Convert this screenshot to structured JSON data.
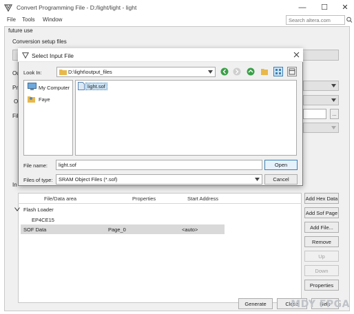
{
  "window": {
    "title": "Convert Programming File - D:/light/light - light",
    "controls": {
      "minimize": "—",
      "maximize": "☐",
      "close": "✕"
    }
  },
  "menu": {
    "items": [
      "File",
      "Tools",
      "Window"
    ]
  },
  "search": {
    "placeholder": "Search altera.com"
  },
  "panel": {
    "top_label": "future use",
    "conversion_title": "Conversion setup files",
    "left_labels": [
      "Ou",
      "Pr",
      "O",
      "Fil"
    ],
    "input_group_label": "In"
  },
  "table": {
    "headers": [
      "File/Data area",
      "Properties",
      "Start Address"
    ],
    "tree": {
      "flash_loader": "Flash Loader",
      "device": "EP4CE15",
      "sof_row": {
        "name": "SOF Data",
        "properties": "Page_0",
        "address": "<auto>"
      }
    }
  },
  "side_buttons": {
    "add_hex": "Add Hex Data",
    "add_sof_page": "Add Sof Page",
    "add_file": "Add File...",
    "remove": "Remove",
    "up": "Up",
    "down": "Down",
    "properties": "Properties",
    "more": "..."
  },
  "bottom_buttons": {
    "generate": "Generate",
    "close": "Close",
    "help": "Help"
  },
  "dialog": {
    "title": "Select Input File",
    "look_in_label": "Look In:",
    "look_in_value": "D:\\light\\output_files",
    "places": [
      "My Computer",
      "Faye"
    ],
    "files": [
      "light.sof"
    ],
    "file_name_label": "File name:",
    "file_name_value": "light.sof",
    "file_type_label": "Files of type:",
    "file_type_value": "SRAM Object Files (*.sof)",
    "open": "Open",
    "cancel": "Cancel"
  },
  "watermark": "MDY FPGA",
  "colors": {
    "accent": "#3c7fb1",
    "selection": "#cce4f7",
    "nav_green": "#3aa047",
    "folder": "#e8b84a"
  }
}
